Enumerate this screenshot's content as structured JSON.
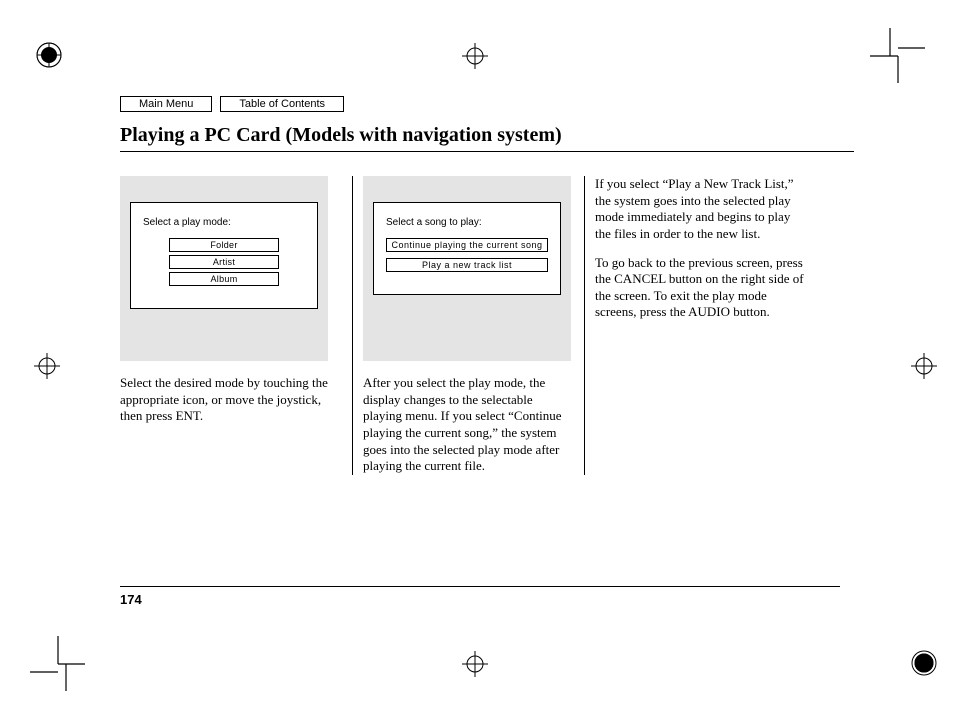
{
  "nav": {
    "main": "Main Menu",
    "toc": "Table of Contents"
  },
  "title": "Playing a PC Card (Models with navigation system)",
  "column1": {
    "panel_title": "Select a play mode:",
    "options": [
      "Folder",
      "Artist",
      "Album"
    ],
    "text": "Select the desired mode by touching the appropriate icon, or move the joystick, then press ENT."
  },
  "column2": {
    "panel_title": "Select a song to play:",
    "options": [
      "Continue playing the  current  song",
      "Play a  new  track  list"
    ],
    "text": "After you select the play mode, the display changes to the selectable playing menu. If you select “Continue playing the current song,” the system goes into the selected play mode after playing the current file."
  },
  "column3": {
    "p1": "If you select “Play a New Track List,” the system goes into the selected play mode immediately and begins to play the files in order to the new list.",
    "p2": "To go back to the previous screen, press the CANCEL button on the right side of the screen. To exit the play mode screens, press the AUDIO button."
  },
  "page_number": "174"
}
